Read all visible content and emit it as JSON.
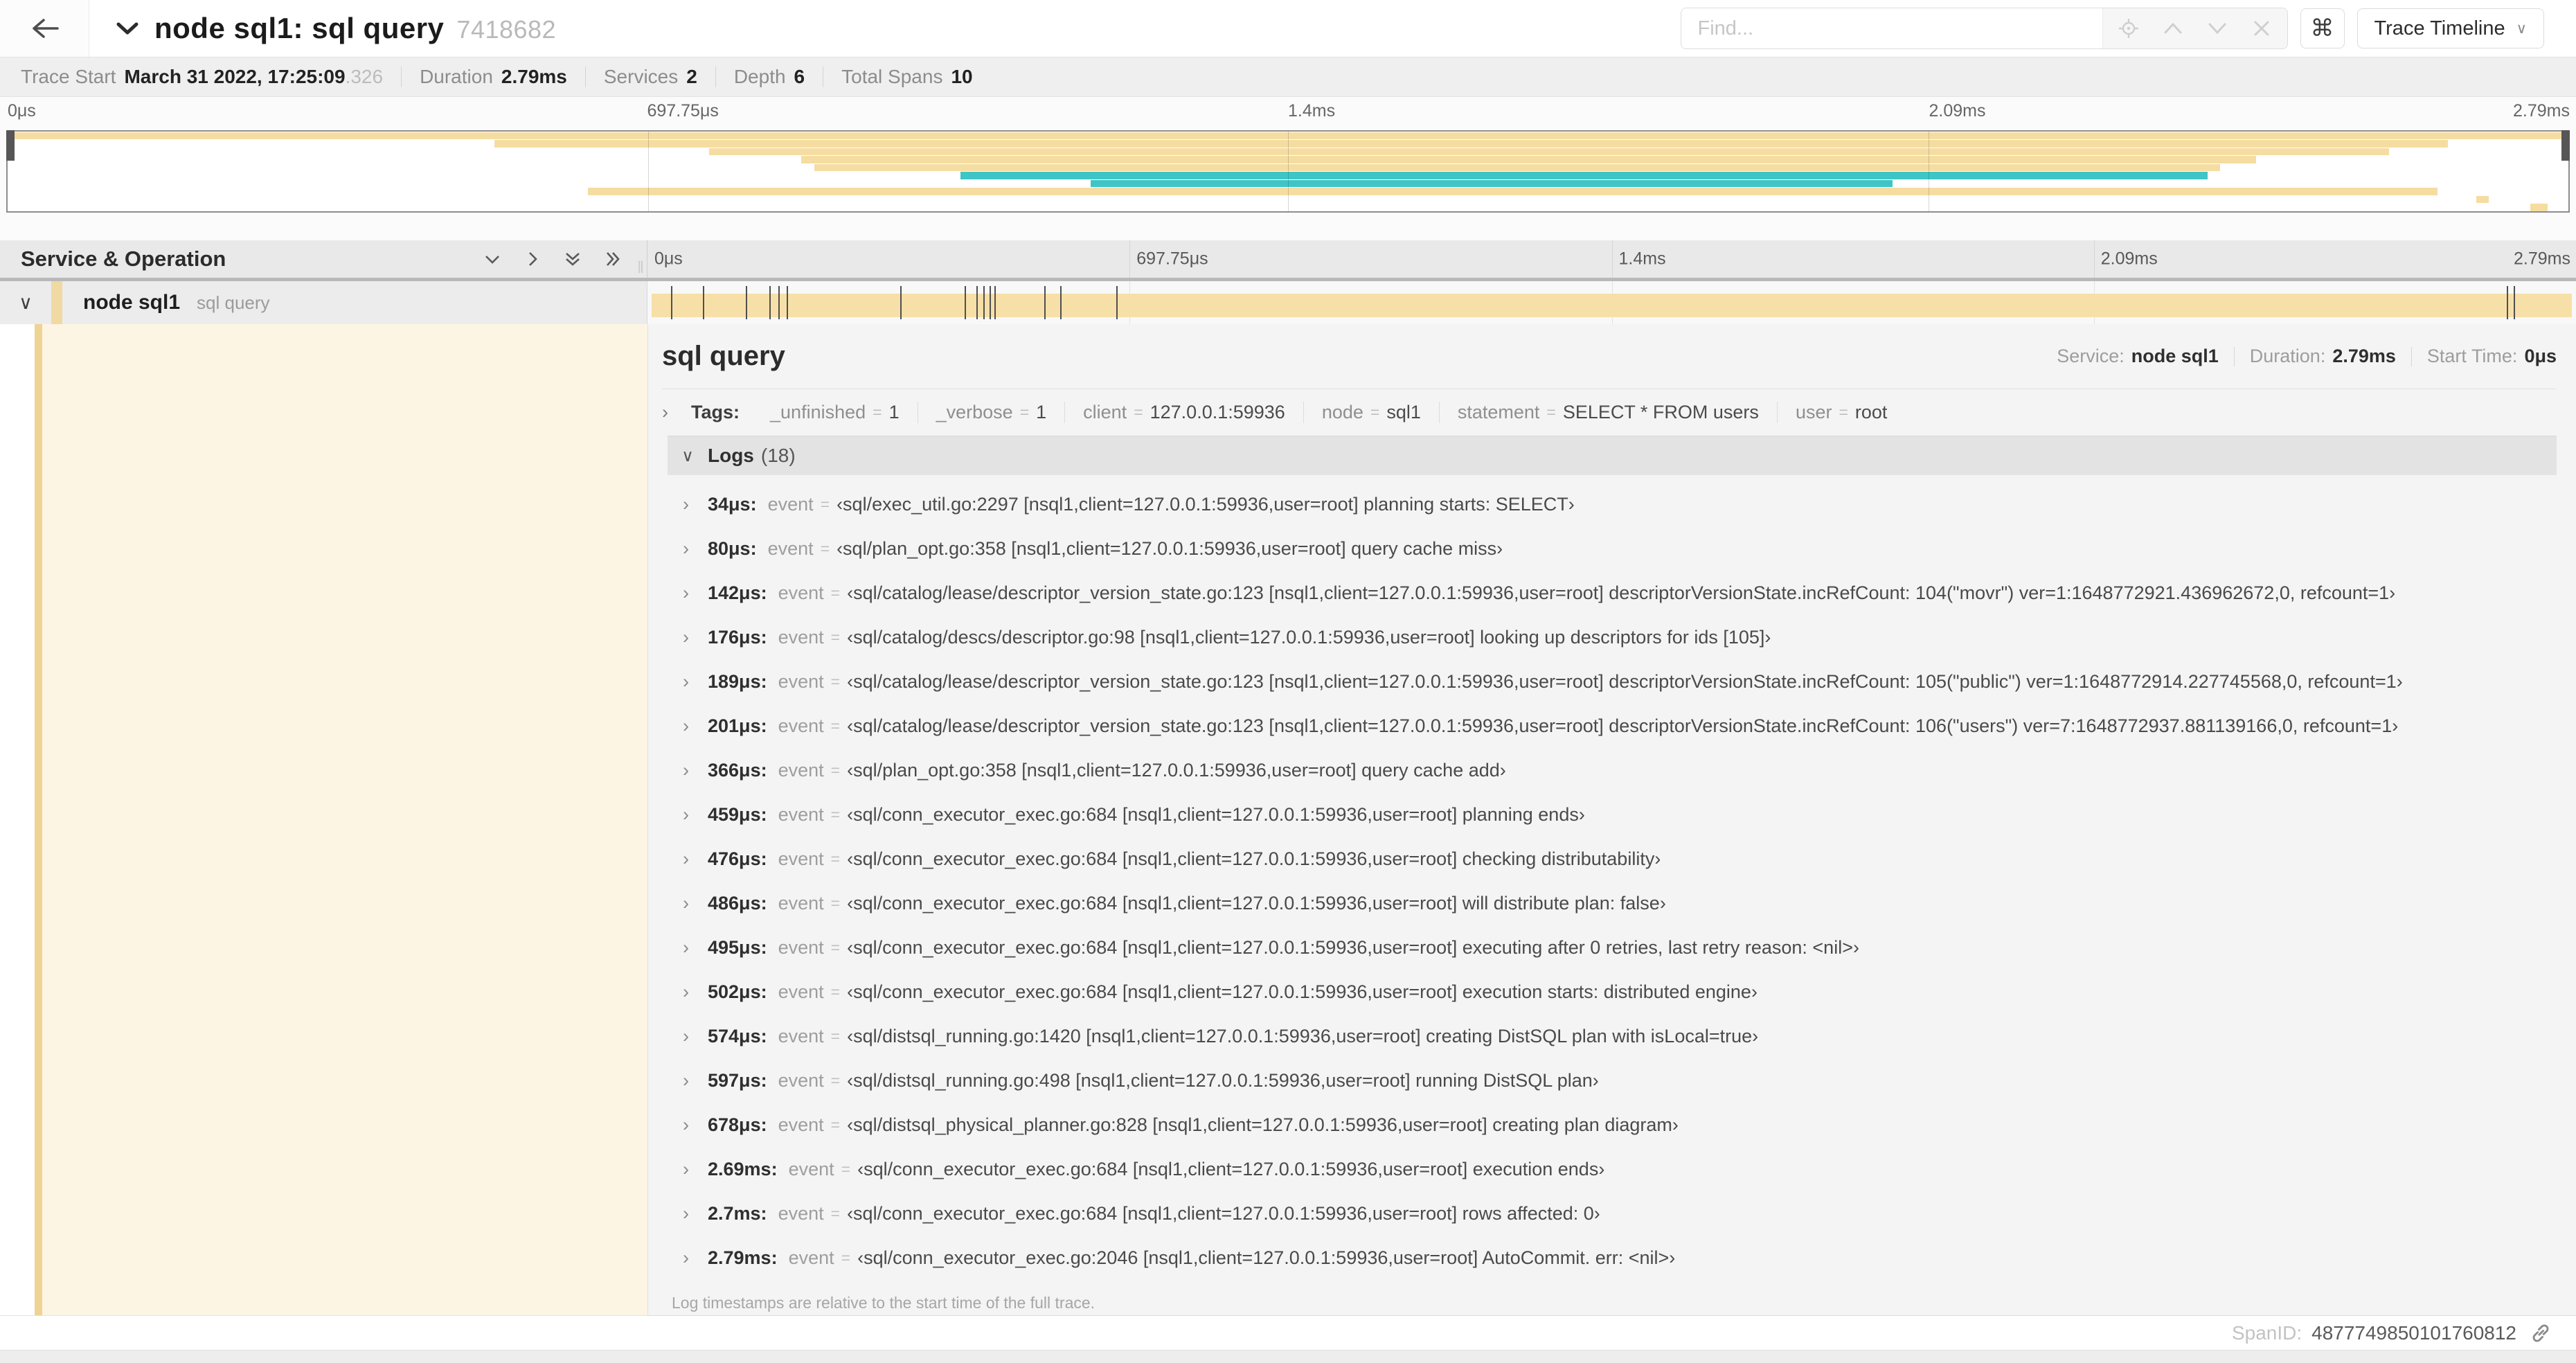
{
  "colors": {
    "tan": "#f5dda2",
    "teal": "#3fc5c5",
    "bar": "#f7e0a8",
    "strip": "#efd392"
  },
  "header": {
    "title": "node sql1: sql query",
    "trace_id": "7418682",
    "find_placeholder": "Find...",
    "shortcut": "⌘",
    "view_select": "Trace Timeline"
  },
  "summary": {
    "trace_start_label": "Trace Start",
    "trace_start": "March 31 2022, 17:25:09",
    "trace_start_frac": ".326",
    "duration_label": "Duration",
    "duration": "2.79ms",
    "services_label": "Services",
    "services": "2",
    "depth_label": "Depth",
    "depth": "6",
    "total_spans_label": "Total Spans",
    "total_spans": "10"
  },
  "timeline_ticks": [
    "0μs",
    "697.75μs",
    "1.4ms",
    "2.09ms",
    "2.79ms"
  ],
  "minimap": {
    "bars": [
      {
        "row": 0,
        "start": 0,
        "end": 1,
        "color": "tan"
      },
      {
        "row": 1,
        "start": 0.19,
        "end": 0.953,
        "color": "tan"
      },
      {
        "row": 2,
        "start": 0.274,
        "end": 0.93,
        "color": "tan"
      },
      {
        "row": 3,
        "start": 0.31,
        "end": 0.878,
        "color": "tan"
      },
      {
        "row": 4,
        "start": 0.315,
        "end": 0.864,
        "color": "tan"
      },
      {
        "row": 5,
        "start": 0.372,
        "end": 0.859,
        "color": "teal"
      },
      {
        "row": 6,
        "start": 0.423,
        "end": 0.736,
        "color": "teal"
      },
      {
        "row": 7,
        "start": 0.2265,
        "end": 0.949,
        "color": "tan"
      },
      {
        "row": 8,
        "start": 0.964,
        "end": 0.969,
        "color": "tan"
      },
      {
        "row": 9,
        "start": 0.985,
        "end": 0.992,
        "color": "tan"
      }
    ]
  },
  "span_table": {
    "header": "Service & Operation",
    "row": {
      "service": "node sql1",
      "operation": "sql query"
    }
  },
  "duration_us": 2790,
  "span_ticks_us": [
    34,
    80,
    142,
    176,
    189,
    201,
    366,
    459,
    476,
    486,
    495,
    502,
    574,
    597,
    678,
    2690,
    2700
  ],
  "detail": {
    "title": "sql query",
    "service_label": "Service:",
    "service": "node sql1",
    "duration_label": "Duration:",
    "duration": "2.79ms",
    "start_label": "Start Time:",
    "start": "0μs",
    "tags_label": "Tags:",
    "tags": [
      {
        "key": "_unfinished",
        "value": "1"
      },
      {
        "key": "_verbose",
        "value": "1"
      },
      {
        "key": "client",
        "value": "127.0.0.1:59936"
      },
      {
        "key": "node",
        "value": "sql1"
      },
      {
        "key": "statement",
        "value": "SELECT * FROM users"
      },
      {
        "key": "user",
        "value": "root"
      }
    ],
    "logs_label": "Logs",
    "logs_count": "(18)",
    "logs": [
      {
        "time": "34μs:",
        "field": "event",
        "value": "‹sql/exec_util.go:2297 [nsql1,client=127.0.0.1:59936,user=root] planning starts: SELECT›"
      },
      {
        "time": "80μs:",
        "field": "event",
        "value": "‹sql/plan_opt.go:358 [nsql1,client=127.0.0.1:59936,user=root] query cache miss›"
      },
      {
        "time": "142μs:",
        "field": "event",
        "value": "‹sql/catalog/lease/descriptor_version_state.go:123 [nsql1,client=127.0.0.1:59936,user=root] descriptorVersionState.incRefCount: 104(\"movr\") ver=1:1648772921.436962672,0, refcount=1›"
      },
      {
        "time": "176μs:",
        "field": "event",
        "value": "‹sql/catalog/descs/descriptor.go:98 [nsql1,client=127.0.0.1:59936,user=root] looking up descriptors for ids [105]›"
      },
      {
        "time": "189μs:",
        "field": "event",
        "value": "‹sql/catalog/lease/descriptor_version_state.go:123 [nsql1,client=127.0.0.1:59936,user=root] descriptorVersionState.incRefCount: 105(\"public\") ver=1:1648772914.227745568,0, refcount=1›"
      },
      {
        "time": "201μs:",
        "field": "event",
        "value": "‹sql/catalog/lease/descriptor_version_state.go:123 [nsql1,client=127.0.0.1:59936,user=root] descriptorVersionState.incRefCount: 106(\"users\") ver=7:1648772937.881139166,0, refcount=1›"
      },
      {
        "time": "366μs:",
        "field": "event",
        "value": "‹sql/plan_opt.go:358 [nsql1,client=127.0.0.1:59936,user=root] query cache add›"
      },
      {
        "time": "459μs:",
        "field": "event",
        "value": "‹sql/conn_executor_exec.go:684 [nsql1,client=127.0.0.1:59936,user=root] planning ends›"
      },
      {
        "time": "476μs:",
        "field": "event",
        "value": "‹sql/conn_executor_exec.go:684 [nsql1,client=127.0.0.1:59936,user=root] checking distributability›"
      },
      {
        "time": "486μs:",
        "field": "event",
        "value": "‹sql/conn_executor_exec.go:684 [nsql1,client=127.0.0.1:59936,user=root] will distribute plan: false›"
      },
      {
        "time": "495μs:",
        "field": "event",
        "value": "‹sql/conn_executor_exec.go:684 [nsql1,client=127.0.0.1:59936,user=root] executing after 0 retries, last retry reason: <nil>›"
      },
      {
        "time": "502μs:",
        "field": "event",
        "value": "‹sql/conn_executor_exec.go:684 [nsql1,client=127.0.0.1:59936,user=root] execution starts: distributed engine›"
      },
      {
        "time": "574μs:",
        "field": "event",
        "value": "‹sql/distsql_running.go:1420 [nsql1,client=127.0.0.1:59936,user=root] creating DistSQL plan with isLocal=true›"
      },
      {
        "time": "597μs:",
        "field": "event",
        "value": "‹sql/distsql_running.go:498 [nsql1,client=127.0.0.1:59936,user=root] running DistSQL plan›"
      },
      {
        "time": "678μs:",
        "field": "event",
        "value": "‹sql/distsql_physical_planner.go:828 [nsql1,client=127.0.0.1:59936,user=root] creating plan diagram›"
      },
      {
        "time": "2.69ms:",
        "field": "event",
        "value": "‹sql/conn_executor_exec.go:684 [nsql1,client=127.0.0.1:59936,user=root] execution ends›"
      },
      {
        "time": "2.7ms:",
        "field": "event",
        "value": "‹sql/conn_executor_exec.go:684 [nsql1,client=127.0.0.1:59936,user=root] rows affected: 0›"
      },
      {
        "time": "2.79ms:",
        "field": "event",
        "value": "‹sql/conn_executor_exec.go:2046 [nsql1,client=127.0.0.1:59936,user=root] AutoCommit. err: <nil>›"
      }
    ],
    "footnote": "Log timestamps are relative to the start time of the full trace.",
    "spanid_label": "SpanID:",
    "spanid": "4877749850101760812"
  }
}
